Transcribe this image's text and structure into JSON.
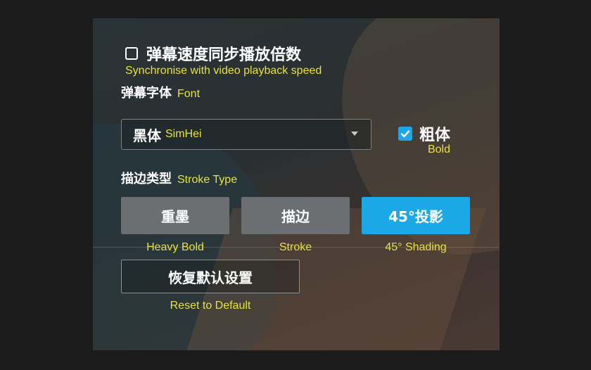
{
  "sync": {
    "label": "弹幕速度同步播放倍数",
    "sub": "Synchronise with video playback speed",
    "checked": false
  },
  "font": {
    "label": "弹幕字体",
    "sub": "Font",
    "selected_cn": "黑体",
    "selected_sub": "SimHei",
    "caret_icon": "chevron-down-icon"
  },
  "bold": {
    "label": "粗体",
    "sub": "Bold",
    "checked": true
  },
  "stroke": {
    "label": "描边类型",
    "sub": "Stroke Type",
    "options": [
      {
        "label": "重墨",
        "sub": "Heavy Bold",
        "active": false
      },
      {
        "label": "描边",
        "sub": "Stroke",
        "active": false
      },
      {
        "label": "45°投影",
        "sub": "45° Shading",
        "active": true
      }
    ]
  },
  "reset": {
    "label": "恢复默认设置",
    "sub": "Reset to Default"
  },
  "colors": {
    "accent": "#1ba8e6",
    "subtitle": "#e8e23a",
    "button": "#6c6f72"
  }
}
